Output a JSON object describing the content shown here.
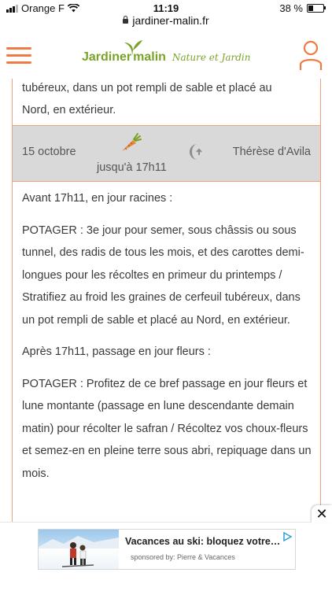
{
  "status_bar": {
    "carrier": "Orange F",
    "time": "11:19",
    "battery": "38 %"
  },
  "browser": {
    "url": "jardiner-malin.fr"
  },
  "site": {
    "logo_part1": "Jardiner",
    "logo_part2": "malin",
    "logo_tagline": "Nature et Jardin"
  },
  "previous_entry": {
    "text_line1": "tubéreux, dans un pot rempli de sable et placé au",
    "text_line2": "Nord, en extérieur."
  },
  "day": {
    "date": "15 octobre",
    "until": "jusqu'à 17h11",
    "saint": "Thérèse d'Avila"
  },
  "body": {
    "p1": "Avant 17h11, en jour racines :",
    "p2": "POTAGER : 3e jour pour semer, sous châssis ou sous tunnel, des radis de tous les mois, et des carottes demi-longues pour les récoltes en primeur du printemps / Stratifiez au froid les graines de cerfeuil tubéreux, dans un pot rempli de sable et placé au Nord, en extérieur.",
    "p3": "Après 17h11, passage en jour fleurs :",
    "p4": "POTAGER : Profitez de ce bref passage en jour fleurs et lune montante (passage en lune descendante demain matin) pour récolter le safran / Récoltez vos choux-fleurs et semez-en en pleine terre sous abri, repiquage dans un mois."
  },
  "ad": {
    "title": "Vacances au ski: bloquez votre…",
    "sponsor": "sponsored by: Pierre & Vacances",
    "close_label": "✕"
  },
  "colors": {
    "accent": "#f07a44",
    "brand_green": "#7aa32a",
    "day_row_bg": "#d9d9d9"
  }
}
